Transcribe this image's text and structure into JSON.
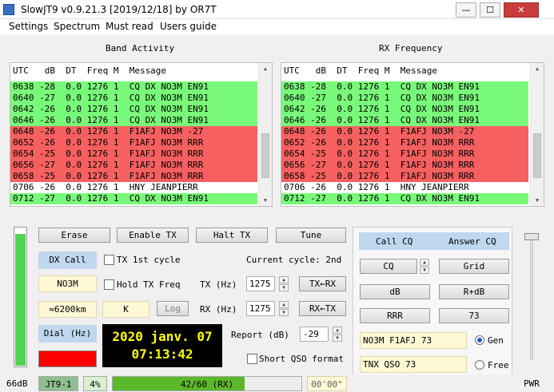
{
  "window": {
    "title": "SlowJT9  v0.9.21.3 [2019/12/18]  by OR7T",
    "min_label": "—",
    "max_label": "☐",
    "close_label": "✕"
  },
  "menu": [
    "Settings",
    "Spectrum",
    "Must read",
    "Users guide"
  ],
  "band_activity": {
    "title": "Band Activity",
    "header": "UTC   dB  DT  Freq M  Message",
    "rows": [
      {
        "text": "0638 -28  0.0 1276 1  CQ DX NO3M EN91",
        "color": "green"
      },
      {
        "text": "0640 -27  0.0 1276 1  CQ DX NO3M EN91",
        "color": "green"
      },
      {
        "text": "0642 -26  0.0 1276 1  CQ DX NO3M EN91",
        "color": "green"
      },
      {
        "text": "0646 -26  0.0 1276 1  CQ DX NO3M EN91",
        "color": "green"
      },
      {
        "text": "0648 -26  0.0 1276 1  F1AFJ NO3M -27",
        "color": "red"
      },
      {
        "text": "0652 -26  0.0 1276 1  F1AFJ NO3M RRR",
        "color": "red"
      },
      {
        "text": "0654 -25  0.0 1276 1  F1AFJ NO3M RRR",
        "color": "red"
      },
      {
        "text": "0656 -27  0.0 1276 1  F1AFJ NO3M RRR",
        "color": "red"
      },
      {
        "text": "0658 -25  0.0 1276 1  F1AFJ NO3M RRR",
        "color": "red"
      },
      {
        "text": "0706 -26  0.0 1276 1  HNY JEANPIERR",
        "color": "white"
      },
      {
        "text": "0712 -27  0.0 1276 1  CQ DX NO3M EN91",
        "color": "green"
      }
    ]
  },
  "rx_frequency": {
    "title": "RX Frequency",
    "header": "UTC   dB  DT  Freq M  Message",
    "rows": [
      {
        "text": "0638 -28  0.0 1276 1  CQ DX NO3M EN91",
        "color": "green"
      },
      {
        "text": "0640 -27  0.0 1276 1  CQ DX NO3M EN91",
        "color": "green"
      },
      {
        "text": "0642 -26  0.0 1276 1  CQ DX NO3M EN91",
        "color": "green"
      },
      {
        "text": "0646 -26  0.0 1276 1  CQ DX NO3M EN91",
        "color": "green"
      },
      {
        "text": "0648 -26  0.0 1276 1  F1AFJ NO3M -27",
        "color": "red"
      },
      {
        "text": "0652 -26  0.0 1276 1  F1AFJ NO3M RRR",
        "color": "red"
      },
      {
        "text": "0654 -25  0.0 1276 1  F1AFJ NO3M RRR",
        "color": "red"
      },
      {
        "text": "0656 -27  0.0 1276 1  F1AFJ NO3M RRR",
        "color": "red"
      },
      {
        "text": "0658 -25  0.0 1276 1  F1AFJ NO3M RRR",
        "color": "red"
      },
      {
        "text": "0706 -26  0.0 1276 1  HNY JEANPIERR",
        "color": "white"
      },
      {
        "text": "0712 -27  0.0 1276 1  CQ DX NO3M EN91",
        "color": "green"
      }
    ]
  },
  "colors": {
    "decode_cq": "#79f979",
    "decode_mine": "#f66060",
    "clock_bg": "#000000",
    "clock_fg": "#ffff00",
    "tx_field": "#fff8d6"
  },
  "controls": {
    "erase": "Erase",
    "enable_tx": "Enable TX",
    "halt_tx": "Halt TX",
    "tune": "Tune",
    "dx_call_label": "DX Call",
    "dx_call_value": "NO3M",
    "distance": "≈6200km",
    "k_value": "K",
    "log": "Log",
    "dial_label": "Dial (Hz)",
    "tx_first": "TX 1st cycle",
    "hold_tx": "Hold TX Freq",
    "current_cycle": "Current cycle: 2nd",
    "tx_hz_label": "TX (Hz)",
    "tx_hz_value": "1275",
    "rx_hz_label": "RX (Hz)",
    "rx_hz_value": "1275",
    "tx_from_rx": "TX←RX",
    "rx_from_tx": "RX←TX",
    "report_label": "Report (dB)",
    "report_value": "-29",
    "short_qso": "Short QSO format",
    "clock_date": "2020 janv. 07",
    "clock_time": "07:13:42",
    "input_level_fraction": 0.95
  },
  "messages": {
    "call_cq": "Call CQ",
    "answer_cq": "Answer CQ",
    "cq": "CQ",
    "grid": "Grid",
    "db": "dB",
    "rdb": "R+dB",
    "rrr": "RRR",
    "seventy_three": "73",
    "gen_message": "NO3M F1AFJ 73",
    "free_message": "TNX QSO 73",
    "gen_label": "Gen",
    "free_label": "Free",
    "selected": "Gen"
  },
  "status": {
    "db_level": "66dB",
    "mode": "JT9-1",
    "percent": "4%",
    "progress_text": "42/60 (RX)",
    "progress_fraction": 0.7,
    "timer": "00'00\"",
    "pwr_label": "PWR"
  }
}
